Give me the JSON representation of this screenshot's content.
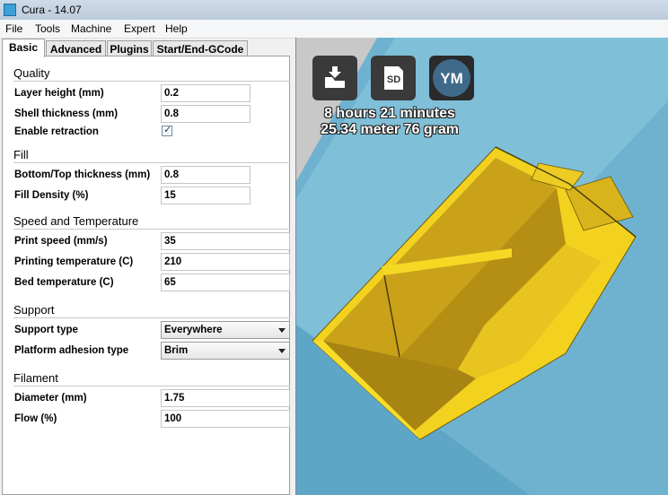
{
  "window": {
    "title": "Cura - 14.07"
  },
  "menu": [
    "File",
    "Tools",
    "Machine",
    "Expert",
    "Help"
  ],
  "tabs": [
    "Basic",
    "Advanced",
    "Plugins",
    "Start/End-GCode"
  ],
  "sections": {
    "quality": {
      "title": "Quality",
      "layer_height": {
        "label": "Layer height (mm)",
        "value": "0.2"
      },
      "shell_thickness": {
        "label": "Shell thickness (mm)",
        "value": "0.8"
      },
      "enable_retraction": {
        "label": "Enable retraction",
        "checked": true
      }
    },
    "fill": {
      "title": "Fill",
      "bottom_top_thickness": {
        "label": "Bottom/Top thickness (mm)",
        "value": "0.8"
      },
      "fill_density": {
        "label": "Fill Density (%)",
        "value": "15"
      }
    },
    "speed": {
      "title": "Speed and Temperature",
      "print_speed": {
        "label": "Print speed (mm/s)",
        "value": "35"
      },
      "printing_temp": {
        "label": "Printing temperature (C)",
        "value": "210"
      },
      "bed_temp": {
        "label": "Bed temperature (C)",
        "value": "65"
      }
    },
    "support": {
      "title": "Support",
      "support_type": {
        "label": "Support type",
        "value": "Everywhere"
      },
      "platform_adhesion": {
        "label": "Platform adhesion type",
        "value": "Brim"
      }
    },
    "filament": {
      "title": "Filament",
      "diameter": {
        "label": "Diameter (mm)",
        "value": "1.75"
      },
      "flow": {
        "label": "Flow (%)",
        "value": "100"
      }
    }
  },
  "viewport": {
    "print_time": "8 hours 21 minutes",
    "material": "25.34 meter 76 gram",
    "buttons": {
      "load": "load-model-icon",
      "sd": "SD",
      "view": "YM"
    },
    "colors": {
      "background": "#6fb2cf",
      "model": "#f0d020",
      "model_dark": "#b8940c"
    }
  }
}
